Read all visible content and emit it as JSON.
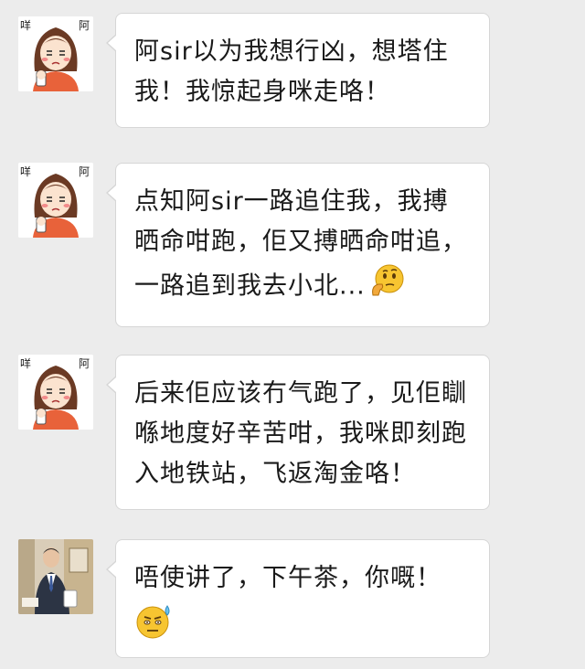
{
  "messages": [
    {
      "sender": "girl",
      "avatar_icon": "cartoon-girl-avatar-icon",
      "text": "阿sir以为我想行凶，想塔住我！我惊起身咪走咯！",
      "emoji": null
    },
    {
      "sender": "girl",
      "avatar_icon": "cartoon-girl-avatar-icon",
      "text": "点知阿sir一路追住我，我搏晒命咁跑，佢又搏晒命咁追，一路追到我去小北...",
      "emoji": "thinking-face-emoji-icon"
    },
    {
      "sender": "girl",
      "avatar_icon": "cartoon-girl-avatar-icon",
      "text": "后来佢应该冇气跑了，见佢瞓喺地度好辛苦咁，我咪即刻跑入地铁站，飞返淘金咯！",
      "emoji": null
    },
    {
      "sender": "man",
      "avatar_icon": "man-in-suit-avatar-icon",
      "text": "唔使讲了，下午茶，你嘅！",
      "emoji": "sweat-face-emoji-icon"
    }
  ],
  "colors": {
    "background": "#ececec",
    "bubble": "#ffffff",
    "bubble_border": "#d6d6d6",
    "text": "#1a1a1a",
    "avatar_hair": "#6b3a24",
    "avatar_shirt": "#e8623a",
    "emoji_yellow": "#f7c531"
  }
}
